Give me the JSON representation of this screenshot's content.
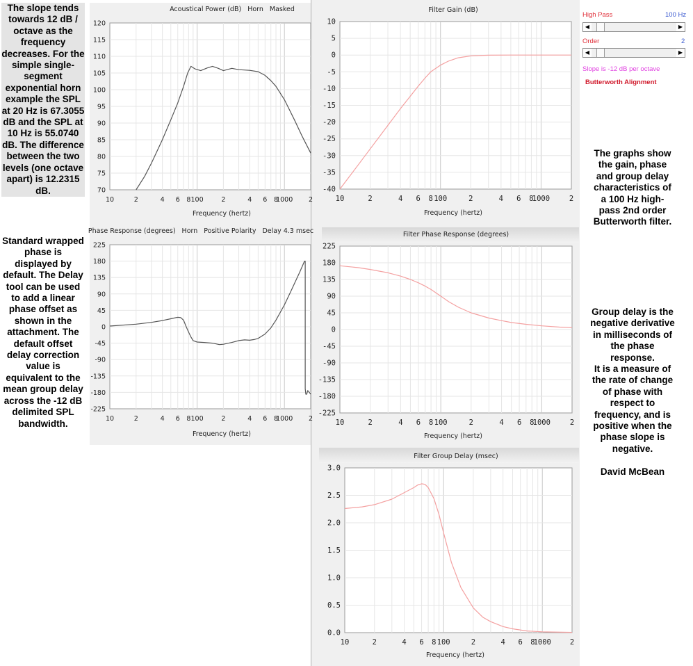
{
  "notes": {
    "left_top": "The slope tends towards 12 dB / octave as the frequency decreases. For the simple single-segment exponential horn example the SPL at 20 Hz is 67.3055 dB and the SPL at 10 Hz is 55.0740 dB. The difference between the two levels (one octave apart) is 12.2315 dB.",
    "left_bottom": "Standard wrapped phase is displayed by default. The Delay tool can be used to add a linear phase offset as shown in the attachment. The default offset delay correction value is equivalent to the mean group delay across the -12 dB delimited SPL bandwidth.",
    "right_mid": "The graphs show the gain, phase and group delay characteristics of a 100 Hz high-pass 2nd order Butterworth filter.",
    "right_low": "Group delay is the negative derivative in milliseconds of the phase response.\nIt is a measure of the rate of change of phase with respect to frequency, and is positive when the phase slope is negative.",
    "author": "David McBean"
  },
  "controls": {
    "high_pass_label": "High Pass",
    "high_pass_value": "100 Hz",
    "order_label": "Order",
    "order_value": "2",
    "slope_text": "Slope is -12 dB per octave",
    "alignment_text": "Butterworth Alignment",
    "high_pass_position": 0.03,
    "order_position": 0.03,
    "label_color": "#e0303a",
    "value_color": "#3a5ad0",
    "slope_color": "#e040e0",
    "alignment_color": "#d0182a"
  },
  "colors": {
    "horn_curve": "#555555",
    "filter_curve": "#f4a0a0",
    "grid_major": "#c8c8c8",
    "grid_minor": "#e6e6e6"
  },
  "chart_data": [
    {
      "id": "acoustical_power",
      "type": "line",
      "title_parts": [
        "Acoustical Power (dB)",
        "Horn",
        "Masked"
      ],
      "xlabel": "Frequency (hertz)",
      "x_scale": "log",
      "xlim": [
        10,
        2000
      ],
      "ylim": [
        70,
        120
      ],
      "yticks": [
        "70",
        "75",
        "80",
        "85",
        "90",
        "95",
        "100",
        "105",
        "110",
        "115",
        "120"
      ],
      "xtick_labels": [
        {
          "v": 10,
          "t": "10"
        },
        {
          "v": 20,
          "t": "2"
        },
        {
          "v": 40,
          "t": "4"
        },
        {
          "v": 60,
          "t": "6"
        },
        {
          "v": 80,
          "t": "8"
        },
        {
          "v": 100,
          "t": "100"
        },
        {
          "v": 200,
          "t": "2"
        },
        {
          "v": 400,
          "t": "4"
        },
        {
          "v": 600,
          "t": "6"
        },
        {
          "v": 800,
          "t": "8"
        },
        {
          "v": 1000,
          "t": "1000"
        },
        {
          "v": 2000,
          "t": "2"
        }
      ],
      "series": [
        {
          "points": [
            [
              20,
              70
            ],
            [
              25,
              74
            ],
            [
              30,
              78
            ],
            [
              40,
              85
            ],
            [
              50,
              91
            ],
            [
              60,
              96
            ],
            [
              70,
              101
            ],
            [
              78,
              105
            ],
            [
              85,
              107
            ],
            [
              95,
              106.2
            ],
            [
              110,
              105.7
            ],
            [
              130,
              106.5
            ],
            [
              150,
              107
            ],
            [
              175,
              106.4
            ],
            [
              200,
              105.7
            ],
            [
              250,
              106.4
            ],
            [
              300,
              106
            ],
            [
              400,
              105.8
            ],
            [
              500,
              105.4
            ],
            [
              600,
              104.3
            ],
            [
              700,
              102.7
            ],
            [
              800,
              101
            ],
            [
              1000,
              97
            ],
            [
              1300,
              91
            ],
            [
              1600,
              86
            ],
            [
              2000,
              81
            ]
          ]
        }
      ]
    },
    {
      "id": "filter_gain",
      "type": "line",
      "title": "Filter Gain (dB)",
      "xlabel": "Frequency (hertz)",
      "x_scale": "log",
      "xlim": [
        10,
        2000
      ],
      "ylim": [
        -40,
        10
      ],
      "yticks": [
        "-40",
        "-35",
        "-30",
        "-25",
        "-20",
        "-15",
        "-10",
        "-5",
        "0",
        "5",
        "10"
      ],
      "xtick_labels": [
        {
          "v": 10,
          "t": "10"
        },
        {
          "v": 20,
          "t": "2"
        },
        {
          "v": 40,
          "t": "4"
        },
        {
          "v": 60,
          "t": "6"
        },
        {
          "v": 80,
          "t": "8"
        },
        {
          "v": 100,
          "t": "100"
        },
        {
          "v": 200,
          "t": "2"
        },
        {
          "v": 400,
          "t": "4"
        },
        {
          "v": 600,
          "t": "6"
        },
        {
          "v": 800,
          "t": "8"
        },
        {
          "v": 1000,
          "t": "1000"
        },
        {
          "v": 2000,
          "t": "2"
        }
      ],
      "series": [
        {
          "points": [
            [
              10,
              -40
            ],
            [
              15,
              -33
            ],
            [
              20,
              -28
            ],
            [
              30,
              -21
            ],
            [
              40,
              -16
            ],
            [
              50,
              -12.3
            ],
            [
              60,
              -9.3
            ],
            [
              70,
              -6.9
            ],
            [
              80,
              -5
            ],
            [
              100,
              -3
            ],
            [
              120,
              -1.8
            ],
            [
              150,
              -0.8
            ],
            [
              200,
              -0.25
            ],
            [
              300,
              -0.05
            ],
            [
              500,
              0
            ],
            [
              1000,
              0
            ],
            [
              2000,
              0
            ]
          ]
        }
      ]
    },
    {
      "id": "phase_response",
      "type": "line",
      "title_parts": [
        "Phase Response (degrees)",
        "Horn",
        "Positive Polarity",
        "Delay 4.3 msec"
      ],
      "xlabel": "Frequency (hertz)",
      "x_scale": "log",
      "xlim": [
        10,
        2000
      ],
      "ylim": [
        -225,
        225
      ],
      "yticks": [
        "-225",
        "-180",
        "-135",
        "-90",
        "-45",
        "0",
        "45",
        "90",
        "135",
        "180",
        "225"
      ],
      "xtick_labels": [
        {
          "v": 10,
          "t": "10"
        },
        {
          "v": 20,
          "t": "2"
        },
        {
          "v": 40,
          "t": "4"
        },
        {
          "v": 60,
          "t": "6"
        },
        {
          "v": 80,
          "t": "8"
        },
        {
          "v": 100,
          "t": "100"
        },
        {
          "v": 200,
          "t": "2"
        },
        {
          "v": 400,
          "t": "4"
        },
        {
          "v": 600,
          "t": "6"
        },
        {
          "v": 800,
          "t": "8"
        },
        {
          "v": 1000,
          "t": "1000"
        },
        {
          "v": 2000,
          "t": "2"
        }
      ],
      "series": [
        {
          "points": [
            [
              10,
              2
            ],
            [
              20,
              7
            ],
            [
              30,
              12
            ],
            [
              40,
              17
            ],
            [
              50,
              22
            ],
            [
              60,
              26
            ],
            [
              65,
              25
            ],
            [
              70,
              18
            ],
            [
              75,
              0
            ],
            [
              80,
              -15
            ],
            [
              85,
              -28
            ],
            [
              90,
              -38
            ],
            [
              100,
              -42
            ],
            [
              120,
              -43
            ],
            [
              150,
              -45
            ],
            [
              180,
              -49
            ],
            [
              200,
              -48
            ],
            [
              250,
              -43
            ],
            [
              300,
              -38
            ],
            [
              350,
              -36
            ],
            [
              400,
              -37
            ],
            [
              450,
              -35
            ],
            [
              500,
              -32
            ],
            [
              600,
              -20
            ],
            [
              700,
              -3
            ],
            [
              800,
              18
            ],
            [
              1000,
              60
            ],
            [
              1200,
              100
            ],
            [
              1500,
              150
            ],
            [
              1700,
              180
            ],
            [
              1730,
              180
            ],
            [
              1730,
              -170
            ],
            [
              1760,
              -185
            ],
            [
              1800,
              -185
            ],
            [
              1850,
              -175
            ],
            [
              1900,
              -178
            ],
            [
              2000,
              -185
            ]
          ]
        }
      ]
    },
    {
      "id": "filter_phase",
      "type": "line",
      "title": "Filter Phase Response (degrees)",
      "xlabel": "Frequency (hertz)",
      "x_scale": "log",
      "xlim": [
        10,
        2000
      ],
      "ylim": [
        -225,
        225
      ],
      "yticks": [
        "-225",
        "-180",
        "-135",
        "-90",
        "-45",
        "0",
        "45",
        "90",
        "135",
        "180",
        "225"
      ],
      "xtick_labels": [
        {
          "v": 10,
          "t": "10"
        },
        {
          "v": 20,
          "t": "2"
        },
        {
          "v": 40,
          "t": "4"
        },
        {
          "v": 60,
          "t": "6"
        },
        {
          "v": 80,
          "t": "8"
        },
        {
          "v": 100,
          "t": "100"
        },
        {
          "v": 200,
          "t": "2"
        },
        {
          "v": 400,
          "t": "4"
        },
        {
          "v": 600,
          "t": "6"
        },
        {
          "v": 800,
          "t": "8"
        },
        {
          "v": 1000,
          "t": "1000"
        },
        {
          "v": 2000,
          "t": "2"
        }
      ],
      "series": [
        {
          "points": [
            [
              10,
              172
            ],
            [
              15,
              167
            ],
            [
              20,
              162
            ],
            [
              30,
              153
            ],
            [
              40,
              144
            ],
            [
              50,
              135
            ],
            [
              60,
              126
            ],
            [
              70,
              117
            ],
            [
              80,
              108
            ],
            [
              100,
              90
            ],
            [
              120,
              75
            ],
            [
              150,
              60
            ],
            [
              200,
              45
            ],
            [
              300,
              31
            ],
            [
              400,
              24
            ],
            [
              500,
              19
            ],
            [
              700,
              14
            ],
            [
              1000,
              10
            ],
            [
              1500,
              6.5
            ],
            [
              2000,
              5
            ]
          ]
        }
      ]
    },
    {
      "id": "filter_group_delay",
      "type": "line",
      "title": "Filter Group Delay (msec)",
      "xlabel": "Frequency (hertz)",
      "x_scale": "log",
      "xlim": [
        10,
        2000
      ],
      "ylim": [
        0,
        3
      ],
      "yticks": [
        "0.0",
        "0.5",
        "1.0",
        "1.5",
        "2.0",
        "2.5",
        "3.0"
      ],
      "xtick_labels": [
        {
          "v": 10,
          "t": "10"
        },
        {
          "v": 20,
          "t": "2"
        },
        {
          "v": 40,
          "t": "4"
        },
        {
          "v": 60,
          "t": "6"
        },
        {
          "v": 80,
          "t": "8"
        },
        {
          "v": 100,
          "t": "100"
        },
        {
          "v": 200,
          "t": "2"
        },
        {
          "v": 400,
          "t": "4"
        },
        {
          "v": 600,
          "t": "6"
        },
        {
          "v": 800,
          "t": "8"
        },
        {
          "v": 1000,
          "t": "1000"
        },
        {
          "v": 2000,
          "t": "2"
        }
      ],
      "series": [
        {
          "points": [
            [
              10,
              2.26
            ],
            [
              15,
              2.29
            ],
            [
              20,
              2.33
            ],
            [
              30,
              2.43
            ],
            [
              40,
              2.55
            ],
            [
              50,
              2.64
            ],
            [
              55,
              2.69
            ],
            [
              60,
              2.71
            ],
            [
              65,
              2.7
            ],
            [
              70,
              2.64
            ],
            [
              80,
              2.44
            ],
            [
              90,
              2.15
            ],
            [
              100,
              1.82
            ],
            [
              120,
              1.28
            ],
            [
              150,
              0.82
            ],
            [
              200,
              0.45
            ],
            [
              250,
              0.28
            ],
            [
              300,
              0.2
            ],
            [
              400,
              0.11
            ],
            [
              500,
              0.07
            ],
            [
              700,
              0.03
            ],
            [
              1000,
              0.015
            ],
            [
              2000,
              0.005
            ]
          ]
        }
      ]
    }
  ]
}
